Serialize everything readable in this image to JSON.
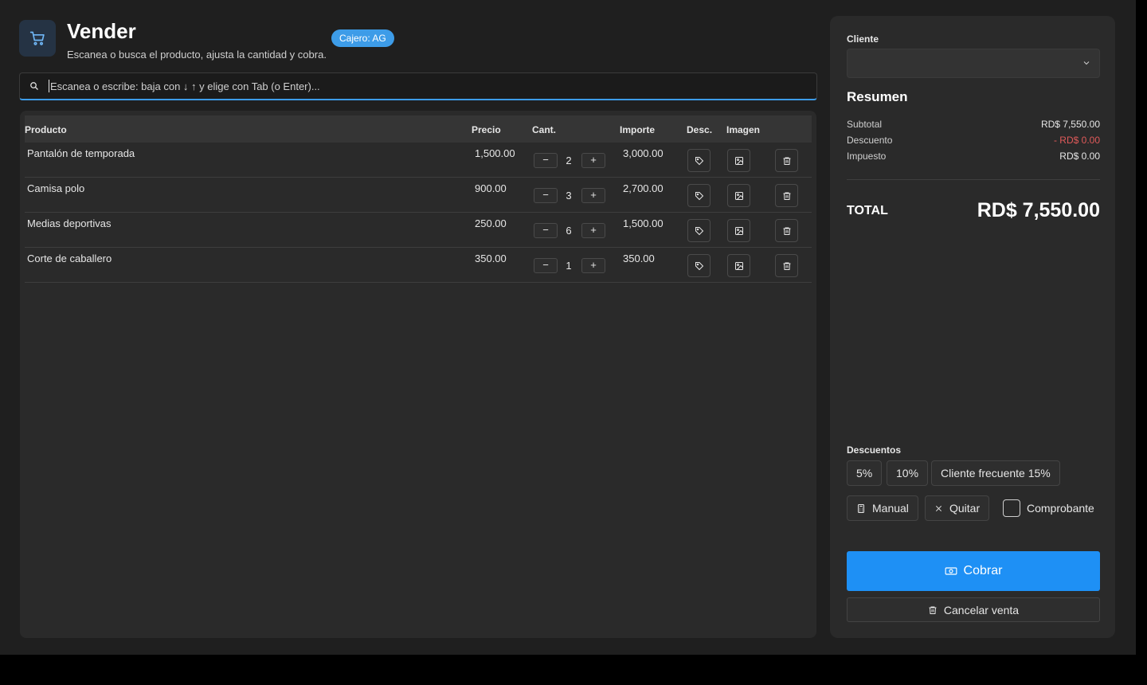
{
  "header": {
    "title": "Vender",
    "subtitle": "Escanea o busca el producto, ajusta la cantidad y cobra.",
    "badge": "Cajero: AG"
  },
  "search": {
    "placeholder": "Escanea o escribe: baja con ↓ ↑ y elige con Tab (o Enter)..."
  },
  "table": {
    "columns": [
      "Producto",
      "Precio",
      "Cant.",
      "Importe",
      "Desc.",
      "Imagen"
    ],
    "rows": [
      {
        "product": "Pantalón de temporada",
        "price": "1,500.00",
        "qty": "2",
        "amount": "3,000.00"
      },
      {
        "product": "Camisa polo",
        "price": "900.00",
        "qty": "3",
        "amount": "2,700.00"
      },
      {
        "product": "Medias deportivas",
        "price": "250.00",
        "qty": "6",
        "amount": "1,500.00"
      },
      {
        "product": "Corte de caballero",
        "price": "350.00",
        "qty": "1",
        "amount": "350.00"
      }
    ],
    "minus": "−",
    "plus": "+"
  },
  "side": {
    "client_label": "Cliente",
    "summary_title": "Resumen",
    "subtotal_label": "Subtotal",
    "subtotal_value": "RD$ 7,550.00",
    "discount_label": "Descuento",
    "discount_value": "- RD$ 0.00",
    "tax_label": "Impuesto",
    "tax_value": "RD$ 0.00",
    "total_label": "TOTAL",
    "total_value": "RD$ 7,550.00",
    "discounts_label": "Descuentos",
    "disc_5": "5%",
    "disc_10": "10%",
    "disc_freq": "Cliente frecuente 15%",
    "manual": "Manual",
    "quitar": "Quitar",
    "comprobante": "Comprobante",
    "cobrar": "Cobrar",
    "cancelar": "Cancelar venta"
  },
  "colors": {
    "accent": "#1e90f5",
    "badge": "#3d9ce8",
    "discount": "#e05a5a"
  }
}
